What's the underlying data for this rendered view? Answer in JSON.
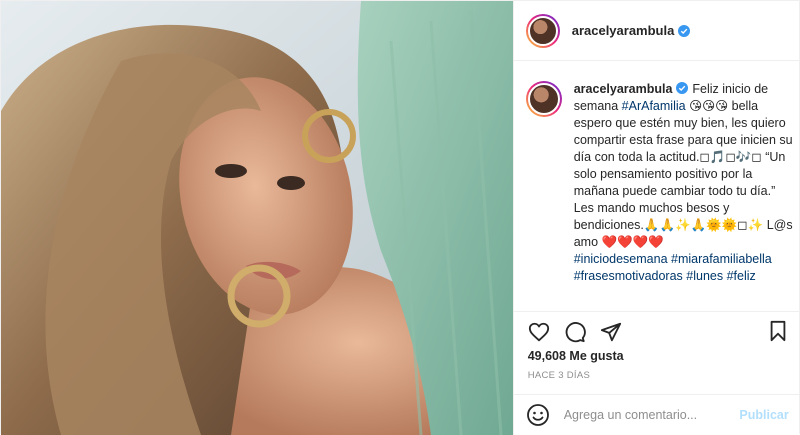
{
  "post": {
    "username": "aracelyarambula",
    "caption": {
      "user": "aracelyarambula",
      "line1_prefix": "Feliz inicio de semana ",
      "hashtag1": "#ArAfamilia",
      "line1_suffix": " 😘😘😘 bella espero que estén muy bien, les quiero compartir esta frase para que inicien su día con toda la actitud.◻🎵◻🎶◻ “Un solo pensamiento positivo por la mañana puede cambiar todo tu día.”",
      "line2": "Les mando muchos besos y bendiciones.🙏🙏✨🙏🌞🌞◻✨ L@s amo ❤️❤️❤️❤️",
      "hashtags": "#iniciodesemana #miarafamiliabella #frasesmotivadoras #lunes #feliz"
    },
    "likes": "49,608 Me gusta",
    "time_ago": "HACE 3 DÍAS",
    "comment_placeholder": "Agrega un comentario...",
    "publish_label": "Publicar",
    "icons": [
      "heart-icon",
      "comment-icon",
      "share-icon",
      "bookmark-icon",
      "smiley-icon",
      "verified-badge-icon"
    ],
    "colors": {
      "verified": "#3897f0",
      "link": "#00376b",
      "publish_disabled": "#b2dffc",
      "meta": "#8e8e8e"
    }
  }
}
